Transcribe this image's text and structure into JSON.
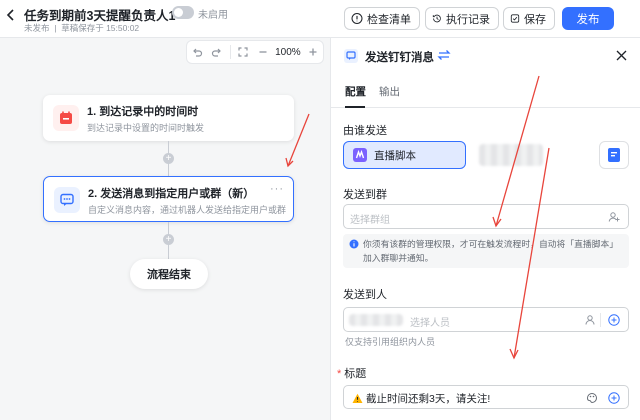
{
  "header": {
    "title": "任务到期前3天提醒负责人1",
    "status": "未发布",
    "draft_saved": "草稿保存于 15:50:02",
    "toggle_label": "未启用",
    "check_label": "检查清单",
    "record_label": "执行记录",
    "save_label": "保存",
    "publish_label": "发布"
  },
  "canvas": {
    "zoom": "100%",
    "nodes": [
      {
        "title": "1. 到达记录中的时间时",
        "desc": "到达记录中设置的时间时触发"
      },
      {
        "title": "2. 发送消息到指定用户或群（新）",
        "desc": "自定义消息内容，通过机器人发送给指定用户或群"
      }
    ],
    "node_more": "···",
    "end_label": "流程结束"
  },
  "panel": {
    "title": "发送钉钉消息",
    "tabs": [
      "配置",
      "输出"
    ],
    "sender_label": "由谁发送",
    "sender_value": "直播脚本",
    "group_label": "发送到群",
    "group_placeholder": "选择群组",
    "info_text": "你须有该群的管理权限，才可在触发流程时，自动将「直播脚本」加入群聊并通知。",
    "person_label": "发送到人",
    "person_placeholder": "选择人员",
    "person_hint": "仅支持引用组织内人员",
    "title_label": "标题",
    "title_required": "*",
    "title_value": "截止时间还剩3天，请关注!"
  },
  "colors": {
    "accent": "#3370ff",
    "annotation_arrow": "#e8453c",
    "node_icon_red": "#f54a45",
    "warning": "#ffb400"
  }
}
